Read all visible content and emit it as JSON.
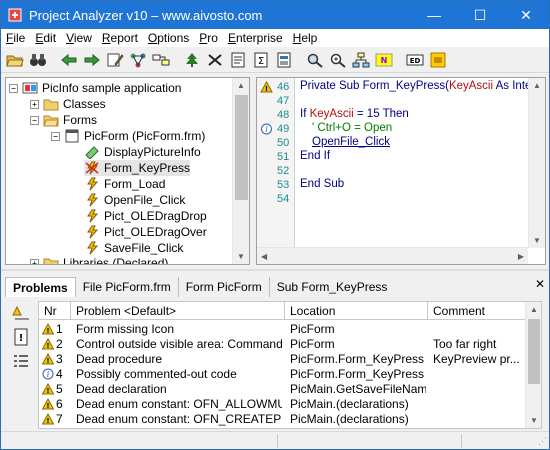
{
  "window": {
    "title": "Project Analyzer v10  –  www.aivosto.com",
    "minimize": "—",
    "maximize": "☐",
    "close": "✕"
  },
  "menu": [
    {
      "label": "File",
      "accel": "F",
      "rest": "ile"
    },
    {
      "label": "Edit",
      "accel": "E",
      "rest": "dit"
    },
    {
      "label": "View",
      "accel": "V",
      "rest": "iew"
    },
    {
      "label": "Report",
      "accel": "R",
      "rest": "eport"
    },
    {
      "label": "Options",
      "accel": "O",
      "rest": "ptions"
    },
    {
      "label": "Pro",
      "accel": "P",
      "rest": "ro"
    },
    {
      "label": "Enterprise",
      "accel": "E",
      "rest": "nterprise"
    },
    {
      "label": "Help",
      "accel": "H",
      "rest": "elp"
    }
  ],
  "toolbar": {
    "icons": [
      "open-folder-icon",
      "binoculars-icon",
      "back-arrow-icon",
      "forward-arrow-icon",
      "edit-icon",
      "network-icon",
      "cross-reference-icon",
      "tree-icon",
      "remove-dead-icon",
      "document-icon",
      "summary-icon",
      "report-icon",
      "find-icon",
      "zoom-icon",
      "diagram-icon",
      "nd-icon",
      "ed-icon",
      "enterprise-icon"
    ]
  },
  "tree": {
    "root": "PicInfo sample application",
    "classes": "Classes",
    "forms": "Forms",
    "picform": "PicForm (PicForm.frm)",
    "items": [
      "DisplayPictureInfo",
      "Form_KeyPress",
      "Form_Load",
      "OpenFile_Click",
      "Pict_OLEDragDrop",
      "Pict_OLEDragOver",
      "SaveFile_Click"
    ],
    "libraries": "Libraries (Declared)"
  },
  "code": {
    "lines": [
      {
        "num": "46",
        "mark": "warn"
      },
      {
        "num": "47",
        "mark": ""
      },
      {
        "num": "48",
        "mark": ""
      },
      {
        "num": "49",
        "mark": "info"
      },
      {
        "num": "50",
        "mark": ""
      },
      {
        "num": "51",
        "mark": ""
      },
      {
        "num": "52",
        "mark": ""
      },
      {
        "num": "53",
        "mark": ""
      },
      {
        "num": "54",
        "mark": ""
      }
    ],
    "l46a": "Private Sub ",
    "l46b": "Form_KeyPress",
    "l46c": "(",
    "l46d": "KeyAscii",
    "l46e": " As Integer)",
    "l48a": "If ",
    "l48b": "KeyAscii",
    "l48c": " = 15 Then",
    "l49": "' Ctrl+O = Open",
    "l50": "OpenFile_Click",
    "l51": "End If",
    "l53": "End Sub"
  },
  "tabs": [
    "Problems",
    "File PicForm.frm",
    "Form PicForm",
    "Sub Form_KeyPress"
  ],
  "tab_close": "✕",
  "grid": {
    "headers": [
      "Nr",
      "Problem <Default>",
      "Location",
      "Comment"
    ],
    "rows": [
      {
        "nr": "1",
        "kind": "warn",
        "problem": "Form missing Icon",
        "location": "PicForm",
        "comment": ""
      },
      {
        "nr": "2",
        "kind": "warn",
        "problem": "Control outside visible area: CommandB...",
        "location": "PicForm",
        "comment": "Too far right"
      },
      {
        "nr": "3",
        "kind": "warn",
        "problem": "Dead procedure",
        "location": "PicForm.Form_KeyPress",
        "comment": "KeyPreview pr..."
      },
      {
        "nr": "4",
        "kind": "info",
        "problem": "Possibly commented-out code",
        "location": "PicForm.Form_KeyPress",
        "comment": ""
      },
      {
        "nr": "5",
        "kind": "warn",
        "problem": "Dead declaration",
        "location": "PicMain.GetSaveFileNameA",
        "comment": ""
      },
      {
        "nr": "6",
        "kind": "warn",
        "problem": "Dead enum constant: OFN_ALLOWMUL...",
        "location": "PicMain.(declarations)",
        "comment": ""
      },
      {
        "nr": "7",
        "kind": "warn",
        "problem": "Dead enum constant: OFN_CREATEPRO...",
        "location": "PicMain.(declarations)",
        "comment": ""
      }
    ]
  },
  "colors": {
    "titlebar": "#1e75d6",
    "warning": "#f5c400",
    "info": "#2b5fb3",
    "keyword": "#000080"
  }
}
